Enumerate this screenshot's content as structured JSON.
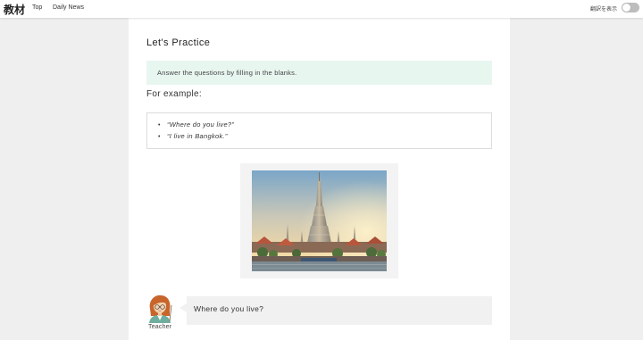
{
  "header": {
    "logo": "教材",
    "nav": [
      {
        "label": "Top"
      },
      {
        "label": "Daily News"
      }
    ],
    "translation_toggle": {
      "label": "翻訳を表示",
      "state": "off"
    }
  },
  "lesson": {
    "title": "Let's Practice",
    "instructions": "Answer the questions by filling in the blanks.",
    "example_heading": "For example:",
    "examples": [
      "“Where do you live?”",
      "“I live in Bangkok.”"
    ],
    "dialogue": [
      {
        "speaker": "Teacher",
        "text": "Where do you live?"
      }
    ]
  },
  "colors": {
    "page_background": "#efefef",
    "instructions_background": "#e8f6f0",
    "bubble_background": "#f1f1f1",
    "toggle_off": "#bdbdbd"
  }
}
